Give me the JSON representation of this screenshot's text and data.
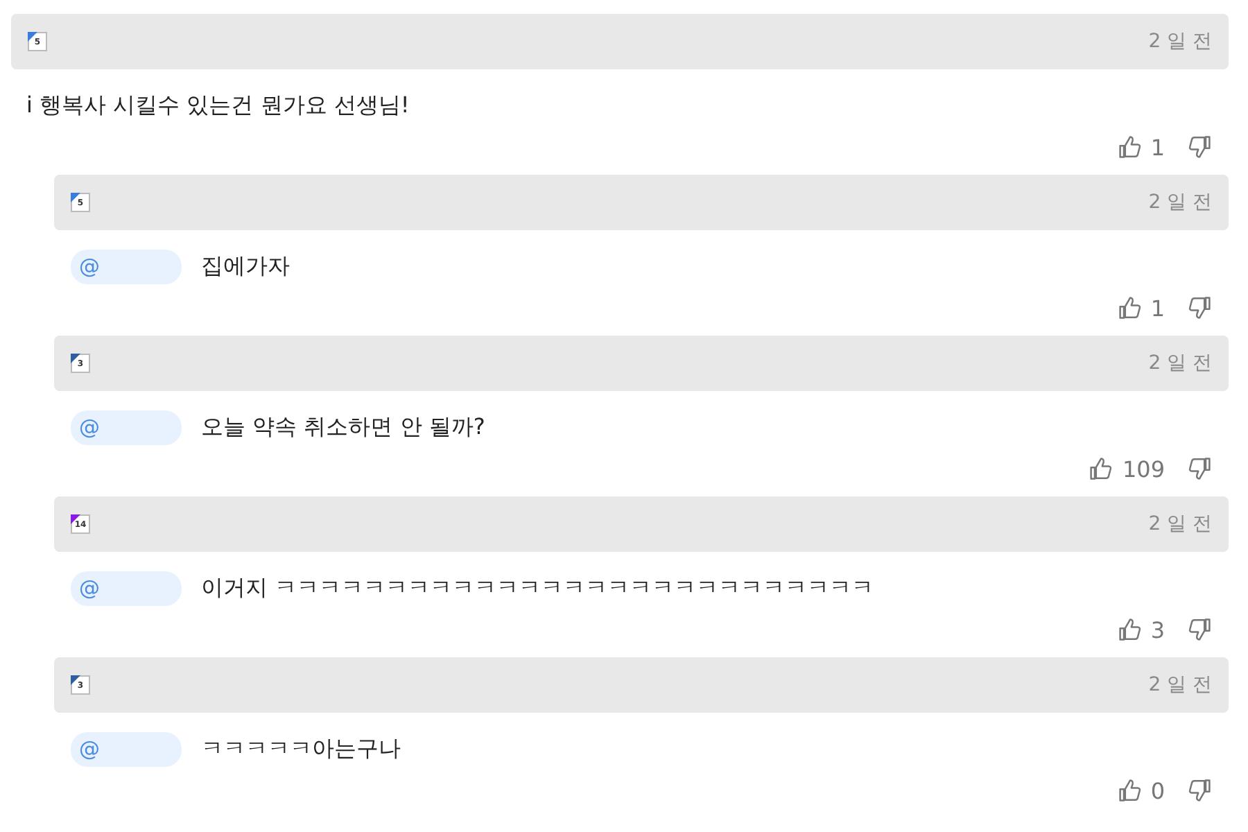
{
  "comments": [
    {
      "kind": "top",
      "rank": "5",
      "color": "#3b7ddd",
      "time": "2 일 전",
      "text": "i 행복사 시킬수 있는건 뭔가요 선생님!",
      "likes": "1"
    },
    {
      "kind": "reply",
      "rank": "5",
      "color": "#3b7ddd",
      "time": "2 일 전",
      "mention": "@",
      "text": "집에가자",
      "likes": "1"
    },
    {
      "kind": "reply",
      "rank": "3",
      "color": "#2f5f9e",
      "time": "2 일 전",
      "mention": "@",
      "text": "오늘 약속 취소하면 안 될까?",
      "likes": "109"
    },
    {
      "kind": "reply",
      "rank": "14",
      "color": "#8a1be0",
      "time": "2 일 전",
      "mention": "@",
      "text": "이거지 ㅋㅋㅋㅋㅋㅋㅋㅋㅋㅋㅋㅋㅋㅋㅋㅋㅋㅋㅋㅋㅋㅋㅋㅋㅋㅋㅋ",
      "likes": "3"
    },
    {
      "kind": "reply",
      "rank": "3",
      "color": "#2f5f9e",
      "time": "2 일 전",
      "mention": "@",
      "text": "ㅋㅋㅋㅋㅋ아는구나",
      "likes": "0"
    }
  ]
}
